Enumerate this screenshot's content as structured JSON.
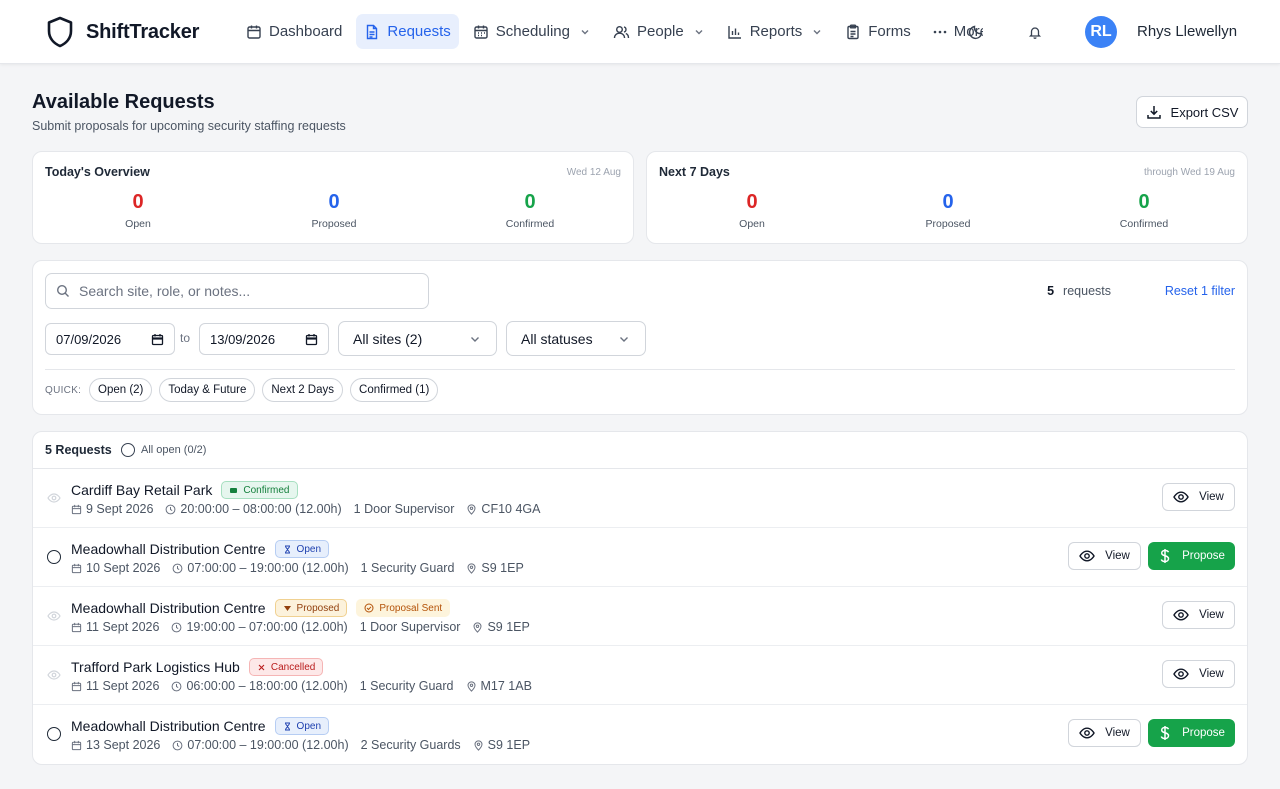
{
  "app": {
    "name": "ShiftTracker",
    "logo_icon": "shield-icon"
  },
  "nav": {
    "items": [
      {
        "label": "Dashboard",
        "icon": "calendar-icon",
        "dropdown": false,
        "active": false
      },
      {
        "label": "Requests",
        "icon": "document-icon",
        "dropdown": false,
        "active": true
      },
      {
        "label": "Scheduling",
        "icon": "calendar-icon",
        "dropdown": true,
        "active": false
      },
      {
        "label": "People",
        "icon": "users-icon",
        "dropdown": true,
        "active": false
      },
      {
        "label": "Reports",
        "icon": "bar-chart-icon",
        "dropdown": true,
        "active": false
      },
      {
        "label": "Forms",
        "icon": "clipboard-icon",
        "dropdown": false,
        "active": false
      },
      {
        "label": "More",
        "icon": "more-icon",
        "dropdown": false,
        "active": false
      }
    ]
  },
  "header": {
    "theme_icon": "moon-icon",
    "notifications_icon": "bell-icon",
    "user": {
      "initials": "RL",
      "name": "Rhys Llewellyn",
      "avatar_color": "#3b82f6"
    }
  },
  "page": {
    "title": "Available Requests",
    "subtitle": "Submit proposals for upcoming security staffing requests",
    "export_label": "Export CSV"
  },
  "overview": {
    "today": {
      "title": "Today's Overview",
      "date": "Wed 12 Aug",
      "stats": [
        {
          "value": "0",
          "label": "Open",
          "color": "#dc2626"
        },
        {
          "value": "0",
          "label": "Proposed",
          "color": "#2563eb"
        },
        {
          "value": "0",
          "label": "Confirmed",
          "color": "#16a34a"
        }
      ]
    },
    "next7": {
      "title": "Next 7 Days",
      "date": "through Wed 19 Aug",
      "stats": [
        {
          "value": "0",
          "label": "Open",
          "color": "#dc2626"
        },
        {
          "value": "0",
          "label": "Proposed",
          "color": "#2563eb"
        },
        {
          "value": "0",
          "label": "Confirmed",
          "color": "#16a34a"
        }
      ]
    }
  },
  "filters": {
    "search_placeholder": "Search site, role, or notes...",
    "count": "5",
    "count_label": "requests",
    "reset_label": "Reset 1 filter",
    "date_from": "07/09/2026",
    "to_label": "to",
    "date_to": "13/09/2026",
    "sites_select": "All sites (2)",
    "status_select": "All statuses",
    "quick_label": "QUICK:",
    "quick_chips": [
      "Open (2)",
      "Today & Future",
      "Next 2 Days",
      "Confirmed (1)"
    ]
  },
  "list": {
    "title": "5 Requests",
    "select_all_label": "All open (0/2)",
    "view_label": "View",
    "propose_label": "Propose",
    "rows": [
      {
        "site": "Cardiff Bay Retail Park",
        "status": "Confirmed",
        "status_key": "confirmed",
        "extra_badge": "",
        "date": "9 Sept 2026",
        "time": "20:00:00 – 08:00:00 (12.00h)",
        "role": "1 Door Supervisor",
        "postcode": "CF10 4GA",
        "selectable": false,
        "can_propose": false
      },
      {
        "site": "Meadowhall Distribution Centre",
        "status": "Open",
        "status_key": "open",
        "extra_badge": "",
        "date": "10 Sept 2026",
        "time": "07:00:00 – 19:00:00 (12.00h)",
        "role": "1 Security Guard",
        "postcode": "S9 1EP",
        "selectable": true,
        "can_propose": true
      },
      {
        "site": "Meadowhall Distribution Centre",
        "status": "Proposed",
        "status_key": "proposed",
        "extra_badge": "Proposal Sent",
        "date": "11 Sept 2026",
        "time": "19:00:00 – 07:00:00 (12.00h)",
        "role": "1 Door Supervisor",
        "postcode": "S9 1EP",
        "selectable": false,
        "can_propose": false
      },
      {
        "site": "Trafford Park Logistics Hub",
        "status": "Cancelled",
        "status_key": "cancelled",
        "extra_badge": "",
        "date": "11 Sept 2026",
        "time": "06:00:00 – 18:00:00 (12.00h)",
        "role": "1 Security Guard",
        "postcode": "M17 1AB",
        "selectable": false,
        "can_propose": false
      },
      {
        "site": "Meadowhall Distribution Centre",
        "status": "Open",
        "status_key": "open",
        "extra_badge": "",
        "date": "13 Sept 2026",
        "time": "07:00:00 – 19:00:00 (12.00h)",
        "role": "2 Security Guards",
        "postcode": "S9 1EP",
        "selectable": true,
        "can_propose": true
      }
    ]
  }
}
